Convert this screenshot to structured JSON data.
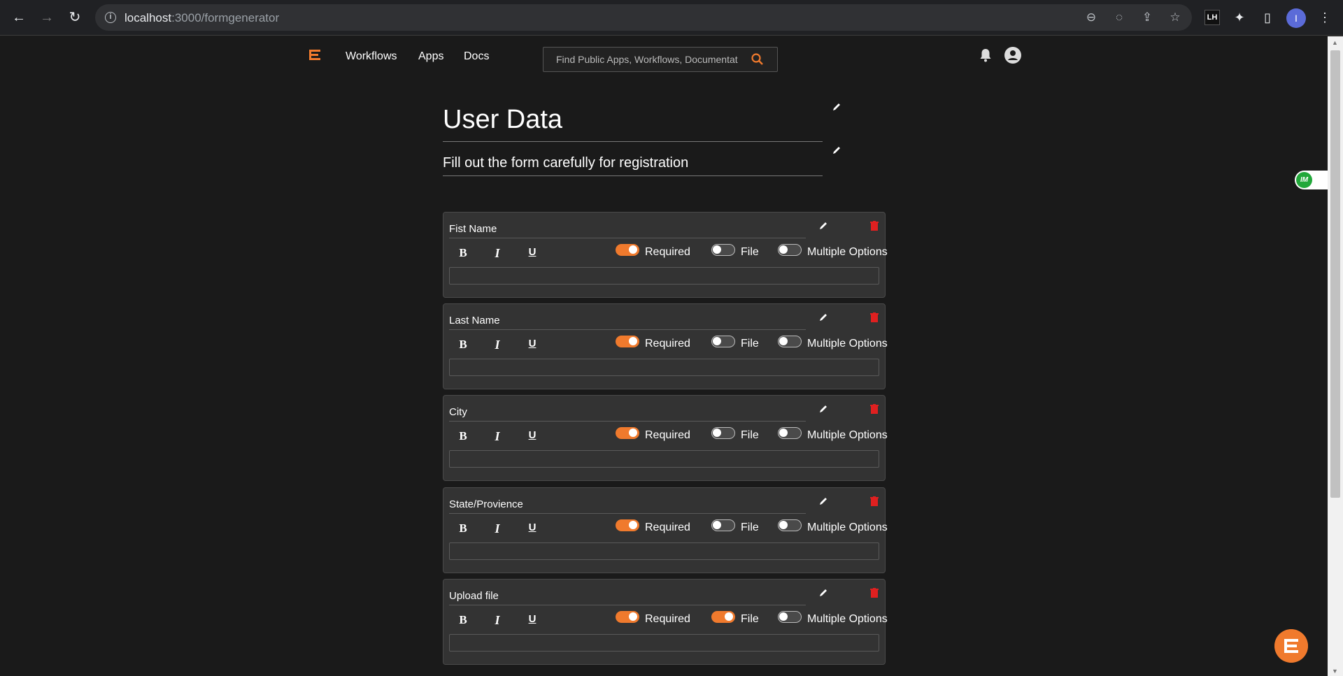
{
  "browser": {
    "url_host": "localhost",
    "url_path": ":3000/formgenerator",
    "profile_initial": "I",
    "lh_label": "LH"
  },
  "nav": {
    "links": [
      "Workflows",
      "Apps",
      "Docs"
    ],
    "search_placeholder": "Find Public Apps, Workflows, Documentation"
  },
  "form": {
    "title": "User Data",
    "description": "Fill out the form carefully for registration",
    "toggle_labels": {
      "required": "Required",
      "file": "File",
      "multiple": "Multiple Options"
    },
    "format_buttons": {
      "bold": "B",
      "italic": "I",
      "underline": "U"
    },
    "questions": [
      {
        "label": "Fist Name",
        "required": true,
        "file": false,
        "multiple": false
      },
      {
        "label": "Last Name",
        "required": true,
        "file": false,
        "multiple": false
      },
      {
        "label": "City",
        "required": true,
        "file": false,
        "multiple": false
      },
      {
        "label": "State/Provience",
        "required": true,
        "file": false,
        "multiple": false
      },
      {
        "label": "Upload file",
        "required": true,
        "file": true,
        "multiple": false
      }
    ]
  },
  "colors": {
    "accent": "#f07a2d",
    "delete": "#e02020",
    "background": "#1a1a1a",
    "card": "#333333"
  }
}
